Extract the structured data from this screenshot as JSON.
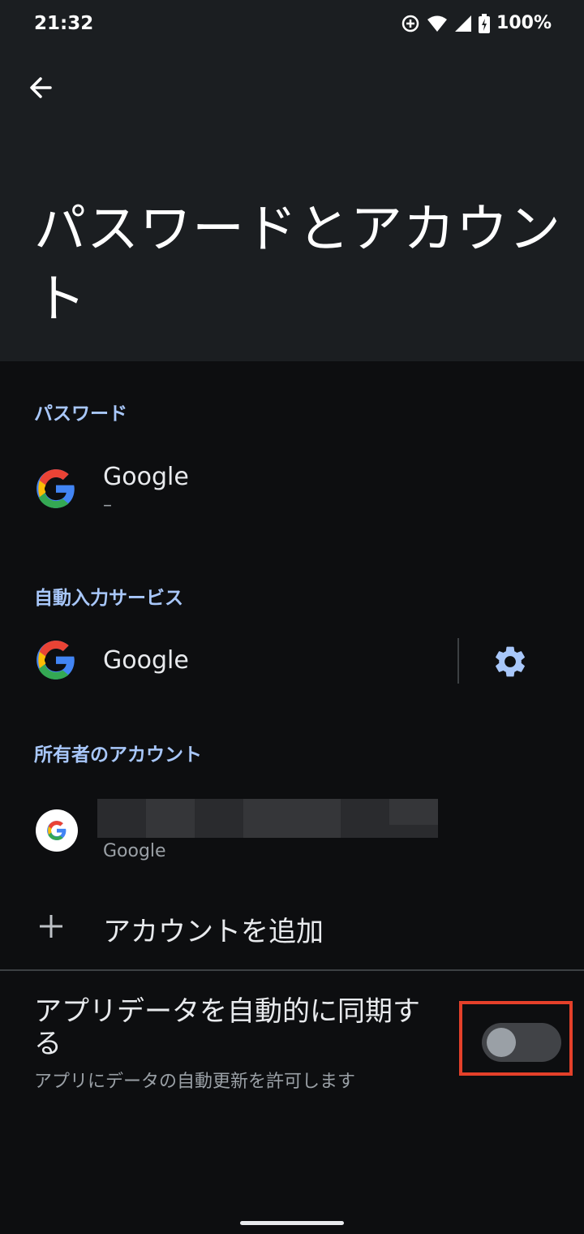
{
  "status": {
    "time": "21:32",
    "battery": "100%"
  },
  "header": {
    "title": "パスワードとアカウント"
  },
  "passwords": {
    "section": "パスワード",
    "item_title": "Google",
    "item_sub": "–"
  },
  "autofill": {
    "section": "自動入力サービス",
    "item_title": "Google",
    "settings_icon": "gear-icon"
  },
  "accounts": {
    "section": "所有者のアカウント",
    "account_type": "Google",
    "add_label": "アカウントを追加"
  },
  "sync": {
    "title": "アプリデータを自動的に同期する",
    "subtitle": "アプリにデータの自動更新を許可します",
    "enabled": false
  },
  "colors": {
    "accent": "#a8c7fa",
    "highlight": "#e4402a"
  }
}
